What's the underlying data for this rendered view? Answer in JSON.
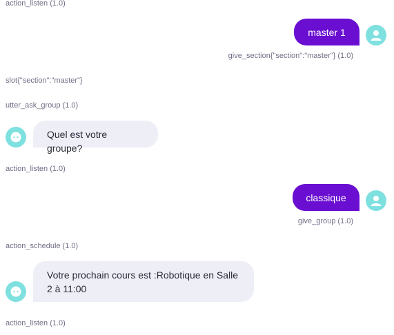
{
  "colors": {
    "user_bubble": "#6a0fd1",
    "bot_bubble": "#eeeef6",
    "avatar": "#7fe0e0",
    "meta_text": "#6f6f86"
  },
  "conversation": {
    "events": [
      {
        "text": "action_listen (1.0)"
      },
      {
        "text": "slot{\"section\":\"master\"}"
      },
      {
        "text": "utter_ask_group (1.0)"
      },
      {
        "text": "action_listen (1.0)"
      },
      {
        "text": "action_schedule (1.0)"
      },
      {
        "text": "action_listen (1.0)"
      }
    ],
    "user_messages": [
      {
        "text": "master 1",
        "intent": "give_section{\"section\":\"master\"} (1.0)",
        "avatar_icon": "user-icon"
      },
      {
        "text": "classique",
        "intent": "give_group (1.0)",
        "avatar_icon": "user-icon"
      }
    ],
    "bot_messages": [
      {
        "text": "Quel est votre groupe?",
        "avatar_icon": "bot-icon"
      },
      {
        "text": "Votre prochain cours est :Robotique en Salle 2 à 11:00",
        "avatar_icon": "bot-icon"
      }
    ]
  }
}
